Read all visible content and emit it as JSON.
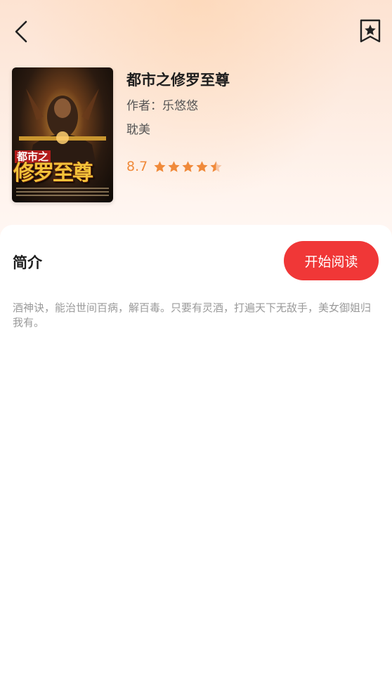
{
  "book": {
    "title": "都市之修罗至尊",
    "author_label": "作者：",
    "author": "乐悠悠",
    "genre": "耽美",
    "rating": "8.7",
    "stars": 4.5,
    "cover": {
      "small_text": "都市之",
      "big_text": "修罗至尊"
    }
  },
  "intro": {
    "heading": "简介",
    "text": "酒神诀，能治世间百病，解百毒。只要有灵酒，打遍天下无敌手，美女御姐归我有。"
  },
  "actions": {
    "read_label": "开始阅读"
  },
  "colors": {
    "accent": "#f03737",
    "rating": "#f08a3a",
    "star_filled": "#f08a3a",
    "star_empty": "#f7c6a6"
  },
  "icons": {
    "back": "back-arrow-icon",
    "bookmark": "bookmark-star-icon",
    "star": "star-icon"
  }
}
